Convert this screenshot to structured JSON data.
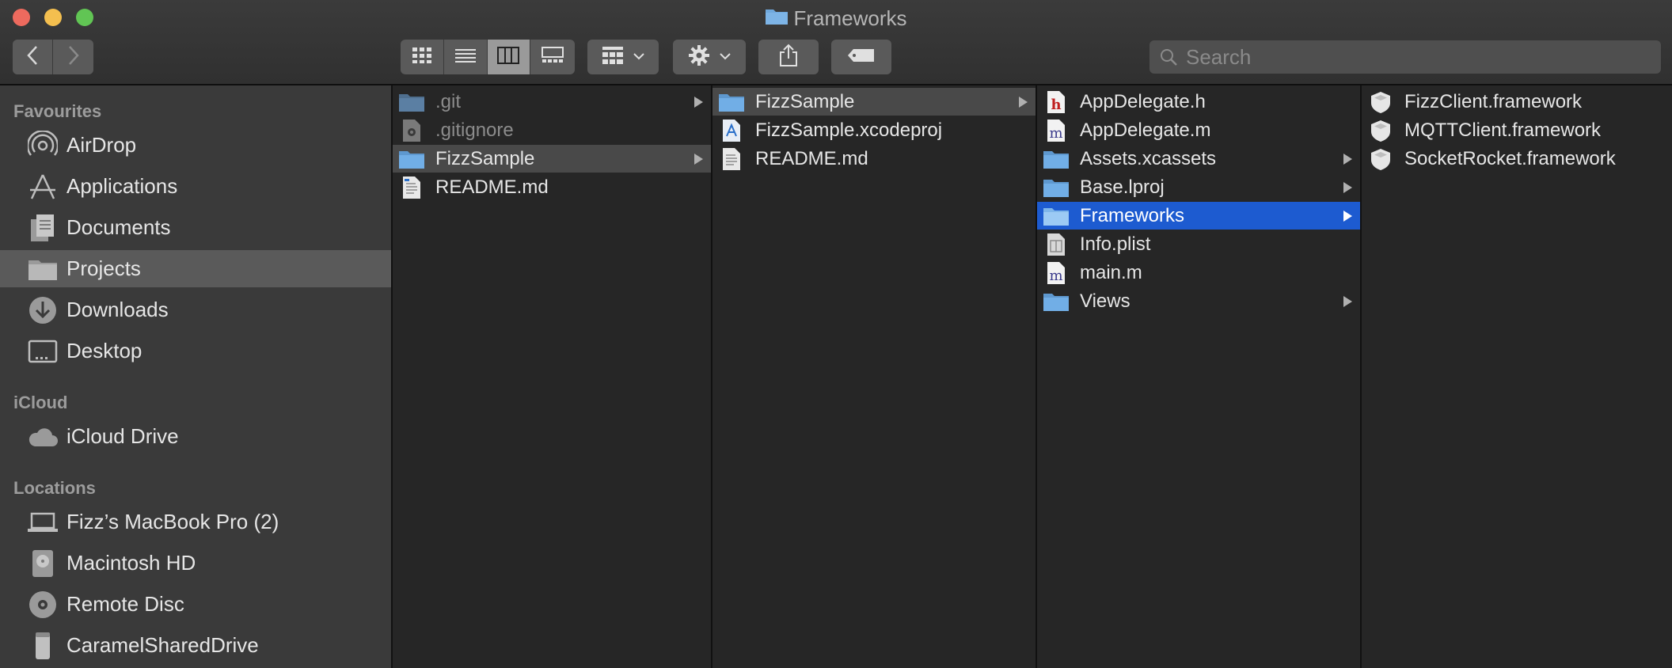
{
  "window": {
    "title": "Frameworks",
    "traffic_lights": {
      "close": "#ed6a5e",
      "minimize": "#f4bf4f",
      "zoom": "#61c554"
    },
    "accent": "#1d5bd0"
  },
  "toolbar": {
    "back_icon": "chevron-left-icon",
    "forward_icon": "chevron-right-icon",
    "view_modes": [
      "icon-view-icon",
      "list-view-icon",
      "column-view-icon",
      "gallery-view-icon"
    ],
    "active_view": "column-view-icon",
    "group_icon": "group-by-icon",
    "action_icon": "gear-icon",
    "share_icon": "share-icon",
    "tag_icon": "tag-icon"
  },
  "search": {
    "placeholder": "Search"
  },
  "sidebar": {
    "sections": [
      {
        "title": "Favourites"
      },
      {
        "title": "iCloud"
      },
      {
        "title": "Locations"
      }
    ],
    "favourites": [
      {
        "label": "AirDrop",
        "icon": "airdrop-icon"
      },
      {
        "label": "Applications",
        "icon": "applications-icon"
      },
      {
        "label": "Documents",
        "icon": "documents-icon"
      },
      {
        "label": "Projects",
        "icon": "folder-icon",
        "selected": true
      },
      {
        "label": "Downloads",
        "icon": "downloads-icon"
      },
      {
        "label": "Desktop",
        "icon": "desktop-icon"
      }
    ],
    "icloud": [
      {
        "label": "iCloud Drive",
        "icon": "cloud-icon"
      }
    ],
    "locations": [
      {
        "label": "Fizz’s MacBook Pro (2)",
        "icon": "laptop-icon"
      },
      {
        "label": "Macintosh HD",
        "icon": "hard-drive-icon"
      },
      {
        "label": "Remote Disc",
        "icon": "disc-icon"
      },
      {
        "label": "CaramelSharedDrive",
        "icon": "external-drive-icon"
      }
    ]
  },
  "columns": [
    {
      "items": [
        {
          "name": ".git",
          "icon": "folder-icon",
          "dim": true,
          "folder": true
        },
        {
          "name": ".gitignore",
          "icon": "file-gear-icon",
          "dim": true
        },
        {
          "name": "FizzSample",
          "icon": "folder-icon",
          "folder": true,
          "selected": "gray"
        },
        {
          "name": "README.md",
          "icon": "text-file-icon"
        }
      ]
    },
    {
      "items": [
        {
          "name": "FizzSample",
          "icon": "folder-icon",
          "folder": true,
          "selected": "gray"
        },
        {
          "name": "FizzSample.xcodeproj",
          "icon": "xcodeproj-icon"
        },
        {
          "name": "README.md",
          "icon": "text-file-icon"
        }
      ]
    },
    {
      "items": [
        {
          "name": "AppDelegate.h",
          "icon": "header-file-icon",
          "letter": "h"
        },
        {
          "name": "AppDelegate.m",
          "icon": "objc-file-icon",
          "letter": "m"
        },
        {
          "name": "Assets.xcassets",
          "icon": "folder-icon",
          "folder": true
        },
        {
          "name": "Base.lproj",
          "icon": "folder-icon",
          "folder": true
        },
        {
          "name": "Frameworks",
          "icon": "folder-icon",
          "folder": true,
          "selected": "blue"
        },
        {
          "name": "Info.plist",
          "icon": "plist-icon"
        },
        {
          "name": "main.m",
          "icon": "objc-file-icon",
          "letter": "m"
        },
        {
          "name": "Views",
          "icon": "folder-icon",
          "folder": true
        }
      ]
    },
    {
      "items": [
        {
          "name": "FizzClient.framework",
          "icon": "framework-icon"
        },
        {
          "name": "MQTTClient.framework",
          "icon": "framework-icon"
        },
        {
          "name": "SocketRocket.framework",
          "icon": "framework-icon"
        }
      ]
    }
  ]
}
